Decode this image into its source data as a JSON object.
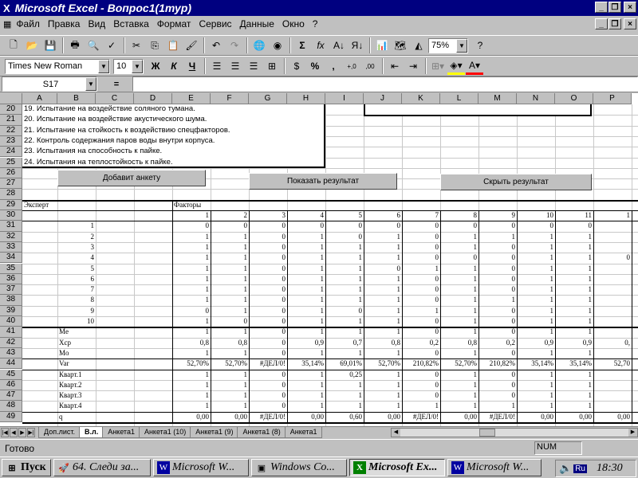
{
  "window": {
    "title": "Microsoft Excel - Вопрос1(1тур)",
    "app_icon": "excel-icon"
  },
  "menu": [
    "Файл",
    "Правка",
    "Вид",
    "Вставка",
    "Формат",
    "Сервис",
    "Данные",
    "Окно",
    "?"
  ],
  "toolbar": {
    "zoom": "75%",
    "font": "Times New Roman",
    "size": "10",
    "bold": "Ж",
    "italic": "К",
    "underline": "Ч",
    "sum": "Σ",
    "fx": "fx",
    "percent": "%",
    "comma": ","
  },
  "formula": {
    "name_box": "S17",
    "equals": "="
  },
  "columns": [
    "A",
    "B",
    "C",
    "D",
    "E",
    "F",
    "G",
    "H",
    "I",
    "J",
    "K",
    "L",
    "M",
    "N",
    "O",
    "P"
  ],
  "rows": [
    "20",
    "21",
    "22",
    "23",
    "24",
    "25",
    "26",
    "27",
    "28",
    "29",
    "30",
    "31",
    "32",
    "33",
    "34",
    "35",
    "36",
    "37",
    "38",
    "39",
    "40",
    "41",
    "42",
    "43",
    "44",
    "45",
    "46",
    "47",
    "48",
    "49"
  ],
  "tests": [
    "19. Испытание на воздействие соляного тумана.",
    "20. Испытание на воздействие акустического шума.",
    "21. Испытание на стойкость к воздействию спецфакторов.",
    "22. Контроль содержания паров воды внутри корпуса.",
    "23. Испытания на способность к пайке.",
    "24. Испытания на теплостойкость к пайке."
  ],
  "buttons": {
    "add": "Добавит анкету",
    "show": "Показать результат",
    "hide": "Скрыть результат"
  },
  "table": {
    "expert_label": "Эксперт",
    "factors_label": "Факторы",
    "factor_numbers": [
      "1",
      "2",
      "3",
      "4",
      "5",
      "6",
      "7",
      "8",
      "9",
      "10",
      "11",
      "1"
    ],
    "experts": [
      "1",
      "2",
      "3",
      "4",
      "5",
      "6",
      "7",
      "8",
      "9",
      "10"
    ],
    "data": [
      [
        "0",
        "0",
        "0",
        "0",
        "0",
        "0",
        "0",
        "0",
        "0",
        "0",
        "0",
        ""
      ],
      [
        "1",
        "1",
        "0",
        "1",
        "0",
        "1",
        "0",
        "1",
        "1",
        "1",
        "1",
        ""
      ],
      [
        "1",
        "1",
        "0",
        "1",
        "1",
        "1",
        "0",
        "1",
        "0",
        "1",
        "1",
        ""
      ],
      [
        "1",
        "1",
        "0",
        "1",
        "1",
        "1",
        "0",
        "0",
        "0",
        "1",
        "1",
        "0"
      ],
      [
        "1",
        "1",
        "0",
        "1",
        "1",
        "0",
        "1",
        "1",
        "0",
        "1",
        "1",
        ""
      ],
      [
        "1",
        "1",
        "0",
        "1",
        "1",
        "1",
        "0",
        "1",
        "0",
        "1",
        "1",
        ""
      ],
      [
        "1",
        "1",
        "0",
        "1",
        "1",
        "1",
        "0",
        "1",
        "0",
        "1",
        "1",
        ""
      ],
      [
        "1",
        "1",
        "0",
        "1",
        "1",
        "1",
        "0",
        "1",
        "1",
        "1",
        "1",
        ""
      ],
      [
        "0",
        "1",
        "0",
        "1",
        "0",
        "1",
        "1",
        "1",
        "0",
        "1",
        "1",
        ""
      ],
      [
        "1",
        "0",
        "0",
        "1",
        "1",
        "1",
        "0",
        "1",
        "0",
        "1",
        "1",
        ""
      ]
    ],
    "stats": [
      {
        "label": "Me",
        "values": [
          "1",
          "1",
          "0",
          "1",
          "1",
          "1",
          "0",
          "1",
          "0",
          "1",
          "1",
          ""
        ]
      },
      {
        "label": "Xcp",
        "values": [
          "0,8",
          "0,8",
          "0",
          "0,9",
          "0,7",
          "0,8",
          "0,2",
          "0,8",
          "0,2",
          "0,9",
          "0,9",
          "0,"
        ]
      },
      {
        "label": "Mo",
        "values": [
          "1",
          "1",
          "0",
          "1",
          "1",
          "1",
          "0",
          "1",
          "0",
          "1",
          "1",
          ""
        ]
      },
      {
        "label": "Var",
        "values": [
          "52,70%",
          "52,70%",
          "#ДЕЛ/0!",
          "35,14%",
          "69,01%",
          "52,70%",
          "210,82%",
          "52,70%",
          "210,82%",
          "35,14%",
          "35,14%",
          "52,70"
        ]
      },
      {
        "label": "Кварт.1",
        "values": [
          "1",
          "1",
          "0",
          "1",
          "0,25",
          "1",
          "0",
          "1",
          "0",
          "1",
          "1",
          ""
        ]
      },
      {
        "label": "Кварт.2",
        "values": [
          "1",
          "1",
          "0",
          "1",
          "1",
          "1",
          "0",
          "1",
          "0",
          "1",
          "1",
          ""
        ]
      },
      {
        "label": "Кварт.3",
        "values": [
          "1",
          "1",
          "0",
          "1",
          "1",
          "1",
          "0",
          "1",
          "0",
          "1",
          "1",
          ""
        ]
      },
      {
        "label": "Кварт.4",
        "values": [
          "1",
          "1",
          "0",
          "1",
          "1",
          "1",
          "1",
          "1",
          "1",
          "1",
          "1",
          ""
        ]
      },
      {
        "label": "q",
        "values": [
          "0,00",
          "0,00",
          "#ДЕЛ/0!",
          "0,00",
          "0,60",
          "0,00",
          "#ДЕЛ/0!",
          "0,00",
          "#ДЕЛ/0!",
          "0,00",
          "0,00",
          "0,00"
        ]
      }
    ]
  },
  "tabs": [
    "Доп.лист.",
    "В.л.",
    "Анкета1",
    "Анкета1 (10)",
    "Анкета1 (9)",
    "Анкета1 (8)",
    "Анкета1"
  ],
  "status": {
    "ready": "Готово",
    "num": "NUM"
  },
  "taskbar": {
    "start": "Пуск",
    "tasks": [
      "64. Следи за...",
      "Microsoft W...",
      "Windows Co...",
      "Microsoft Ex...",
      "Microsoft W..."
    ],
    "lang": "Ru",
    "time": "18:30"
  }
}
